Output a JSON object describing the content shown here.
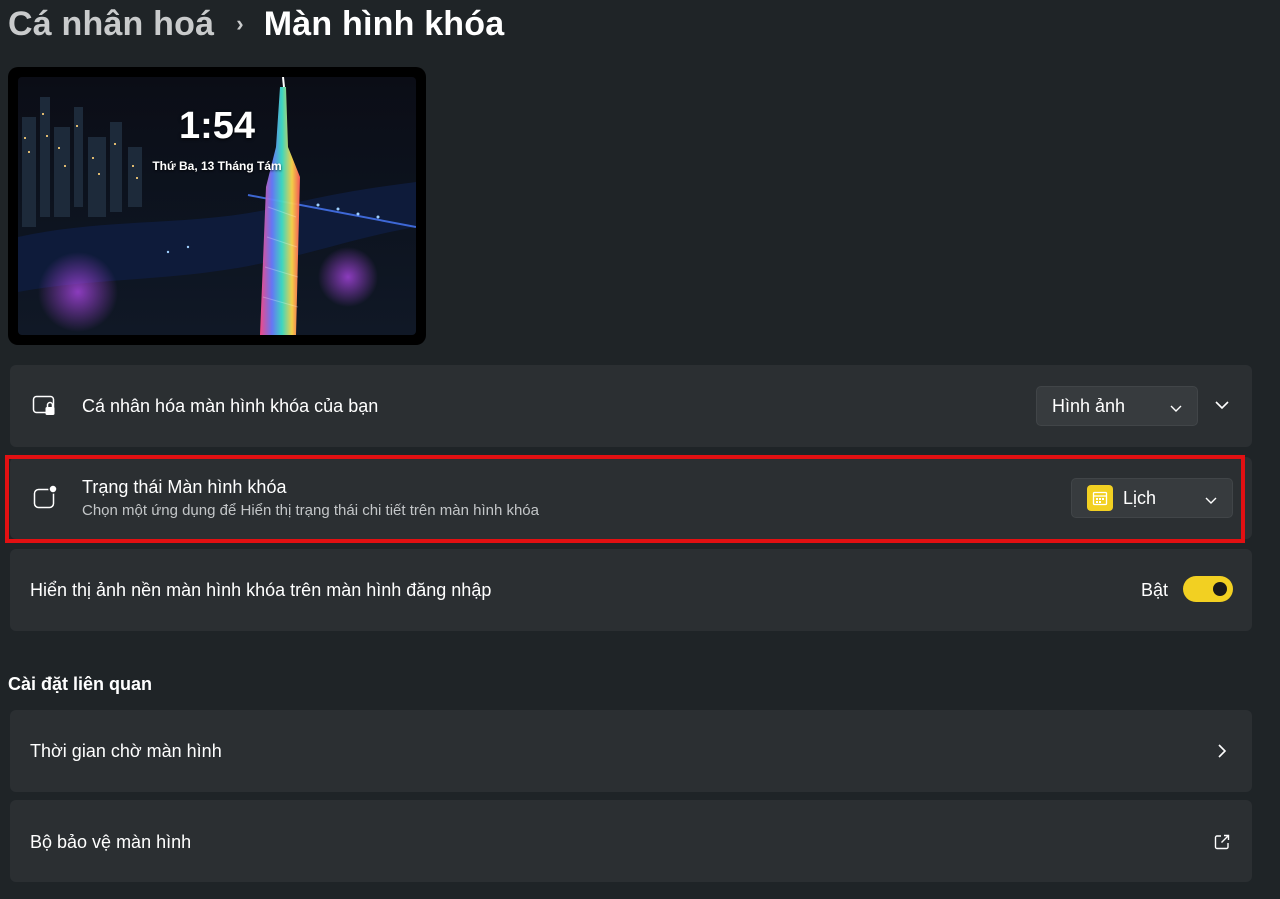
{
  "breadcrumb": {
    "parent": "Cá nhân hoá",
    "separator": "›",
    "current": "Màn hình khóa"
  },
  "preview": {
    "time": "1:54",
    "date": "Thứ Ba, 13 Tháng Tám"
  },
  "settings": {
    "personalize": {
      "title": "Cá nhân hóa màn hình khóa của bạn",
      "dropdown_value": "Hình ảnh",
      "icon": "lock-screen-icon"
    },
    "status": {
      "title": "Trạng thái Màn hình khóa",
      "subtitle": "Chọn một ứng dụng để Hiển thị trạng thái chi tiết trên màn hình khóa",
      "dropdown_value": "Lịch",
      "icon": "status-badge-icon",
      "app_icon": "calendar-app-icon"
    },
    "signin_background": {
      "title": "Hiển thị ảnh nền màn hình khóa trên màn hình đăng nhập",
      "toggle_label": "Bật",
      "toggle_on": true
    }
  },
  "related": {
    "heading": "Cài đặt liên quan",
    "items": [
      {
        "label": "Thời gian chờ màn hình",
        "icon": "chevron-right-icon"
      },
      {
        "label": "Bộ bảo vệ màn hình",
        "icon": "open-external-icon"
      }
    ]
  },
  "colors": {
    "background": "#1f2427",
    "card": "#2b2f32",
    "accent": "#f2d022",
    "highlight": "#e21012"
  }
}
